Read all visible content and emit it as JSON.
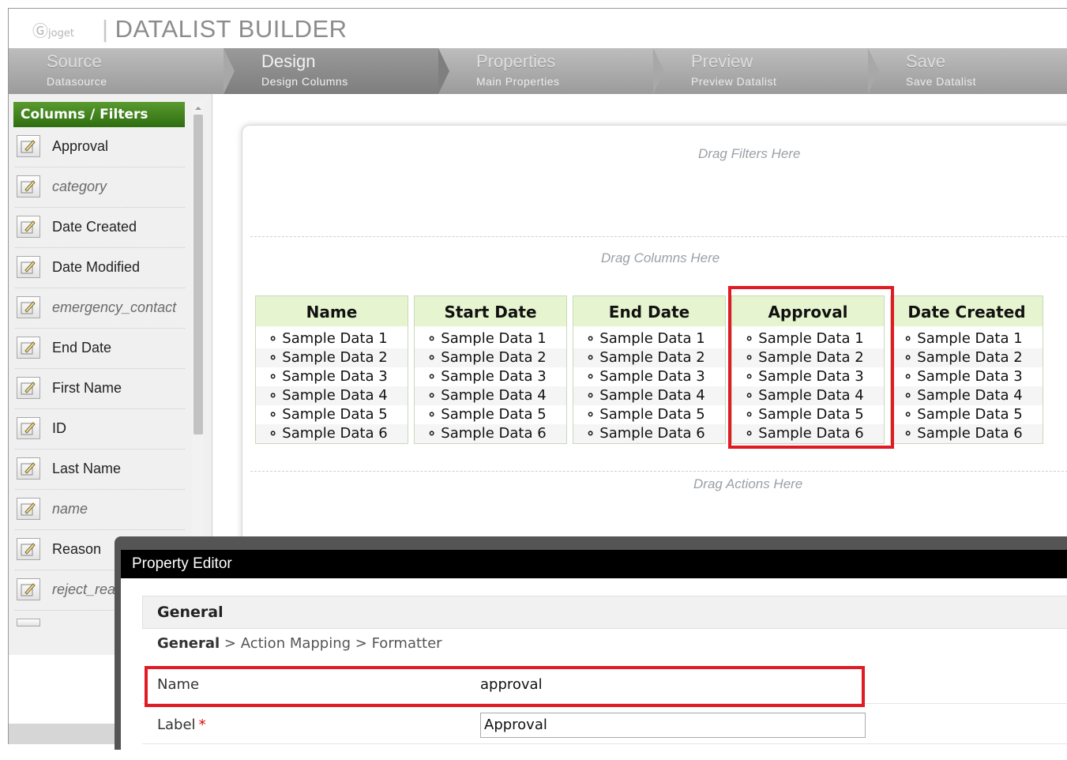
{
  "header": {
    "logo_mark": "Ⓖ",
    "logo_word": "joget",
    "separator": "|",
    "title": "DATALIST BUILDER"
  },
  "steps": [
    {
      "name": "Source",
      "sub": "Datasource",
      "active": false
    },
    {
      "name": "Design",
      "sub": "Design Columns",
      "active": true
    },
    {
      "name": "Properties",
      "sub": "Main Properties",
      "active": false
    },
    {
      "name": "Preview",
      "sub": "Preview Datalist",
      "active": false
    },
    {
      "name": "Save",
      "sub": "Save Datalist",
      "active": false
    }
  ],
  "palette": {
    "title": "Columns / Filters",
    "items": [
      {
        "label": "Approval",
        "italic": false
      },
      {
        "label": "category",
        "italic": true
      },
      {
        "label": "Date Created",
        "italic": false
      },
      {
        "label": "Date Modified",
        "italic": false
      },
      {
        "label": "emergency_contact",
        "italic": true
      },
      {
        "label": "End Date",
        "italic": false
      },
      {
        "label": "First Name",
        "italic": false
      },
      {
        "label": "ID",
        "italic": false
      },
      {
        "label": "Last Name",
        "italic": false
      },
      {
        "label": "name",
        "italic": true
      },
      {
        "label": "Reason",
        "italic": false
      },
      {
        "label": "reject_reason",
        "italic": true
      }
    ]
  },
  "canvas": {
    "filters_hint": "Drag Filters Here",
    "columns_hint": "Drag Columns Here",
    "actions_hint": "Drag Actions Here",
    "columns": [
      {
        "header": "Name"
      },
      {
        "header": "Start Date"
      },
      {
        "header": "End Date"
      },
      {
        "header": "Approval"
      },
      {
        "header": "Date Created"
      }
    ],
    "sample_rows": [
      "Sample Data 1",
      "Sample Data 2",
      "Sample Data 3",
      "Sample Data 4",
      "Sample Data 5",
      "Sample Data 6"
    ]
  },
  "property_editor": {
    "title": "Property Editor",
    "section": "General",
    "breadcrumb_current": "General",
    "breadcrumb_rest": " > Action Mapping > Formatter",
    "name_label": "Name",
    "name_value": "approval",
    "label_label": "Label",
    "required_mark": "*",
    "label_value": "Approval"
  },
  "colors": {
    "highlight": "#e01b24",
    "palette_title": "#3d7e1c",
    "column_header_bg": "#e6f5d0"
  }
}
